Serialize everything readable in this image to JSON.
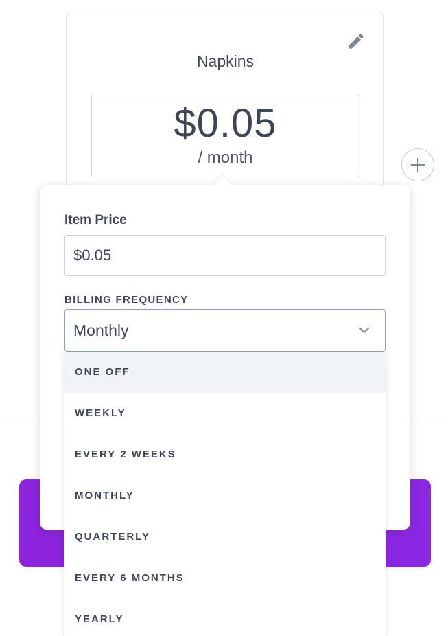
{
  "product": {
    "name": "Napkins",
    "price": "$0.05",
    "period": "/ month"
  },
  "editor": {
    "price_label": "Item Price",
    "price_value": "$0.05",
    "frequency_label": "BILLING FREQUENCY",
    "frequency_selected": "Monthly",
    "frequency_options": [
      "ONE OFF",
      "WEEKLY",
      "EVERY 2 WEEKS",
      "MONTHLY",
      "QUARTERLY",
      "EVERY 6 MONTHS",
      "YEARLY"
    ],
    "highlighted_option_index": 0
  },
  "icons": {
    "edit": "pencil-icon",
    "add": "plus-icon",
    "dropdown": "chevron-down-icon"
  },
  "colors": {
    "cta": "#8a26de",
    "text": "#3d4756",
    "select_border": "#8aa0c0",
    "icon": "#7b8699"
  }
}
